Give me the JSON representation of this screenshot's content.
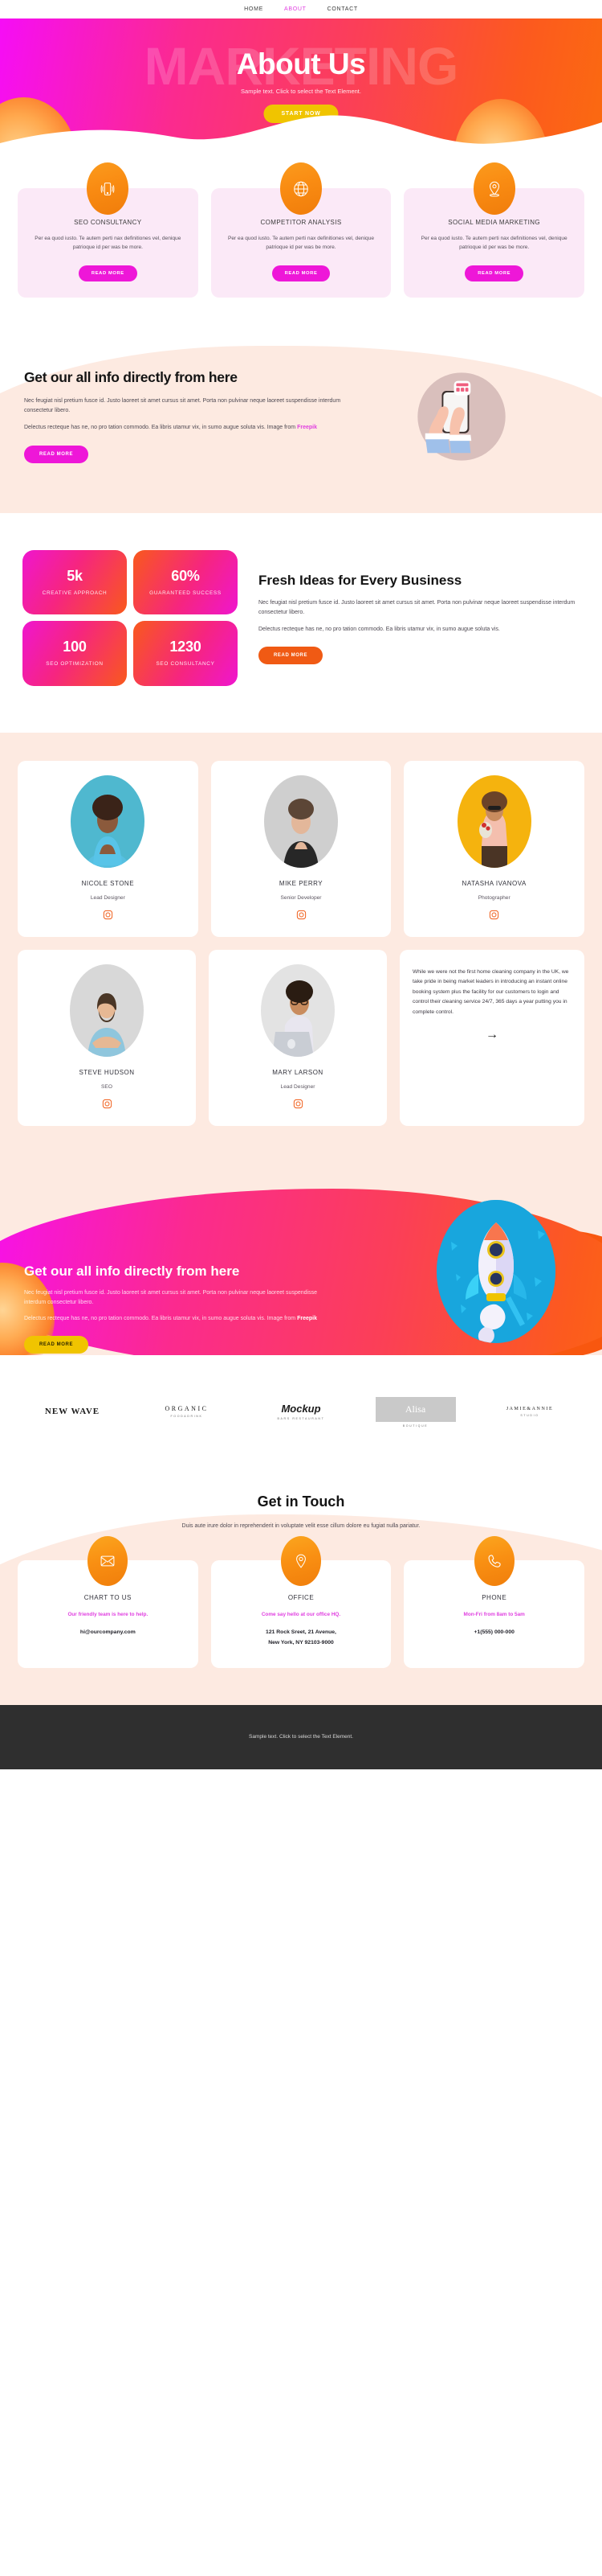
{
  "nav": {
    "items": [
      {
        "label": "HOME",
        "active": false
      },
      {
        "label": "ABOUT",
        "active": true
      },
      {
        "label": "CONTACT",
        "active": false
      }
    ]
  },
  "hero": {
    "ghost_text": "MARKETING",
    "title": "About Us",
    "subtitle": "Sample text. Click to select the Text Element.",
    "cta_label": "START NOW",
    "gradient_from": "#f60df6",
    "gradient_to": "#fb6a10",
    "cta_color": "#f0c400"
  },
  "services": {
    "cards": [
      {
        "icon": "mobile-signal-icon",
        "title": "SEO CONSULTANCY",
        "body": "Per ea quod iusto. Te autem perti nax definitiones vel, denique patrioque id per was be more.",
        "button": "READ MORE"
      },
      {
        "icon": "globe-icon",
        "title": "COMPETITOR ANALYSIS",
        "body": "Per ea quod iusto. Te autem perti nax definitiones vel, denique patrioque id per was be more.",
        "button": "READ MORE"
      },
      {
        "icon": "map-pin-icon",
        "title": "SOCIAL MEDIA MARKETING",
        "body": "Per ea quod iusto. Te autem perti nax definitiones vel, denique patrioque id per was be more.",
        "button": "READ MORE"
      }
    ],
    "card_bg": "#fbe9f7",
    "button_color": "#ee17d8"
  },
  "info": {
    "heading": "Get our all info directly from here",
    "para1": "Nec feugiat nisl pretium fusce id. Justo laoreet sit amet cursus sit amet. Porta non pulvinar neque laoreet suspendisse interdum consectetur libero.",
    "para2_pre": "Delectus recteque has ne, no pro tation commodo. Ea libris utamur vix, in sumo augue soluta vis. Image from ",
    "para2_link": "Freepik",
    "button": "READ MORE",
    "image_alt": "hand-holding-phone-illustration"
  },
  "stats": {
    "tiles": [
      {
        "num": "5k",
        "label": "CREATIVE APPROACH"
      },
      {
        "num": "60%",
        "label": "GUARANTEED SUCCESS"
      },
      {
        "num": "100",
        "label": "SEO OPTIMIZATION"
      },
      {
        "num": "1230",
        "label": "SEO CONSULTANCY"
      }
    ],
    "heading": "Fresh Ideas for Every Business",
    "para1": "Nec feugiat nisl pretium fusce id. Justo laoreet sit amet cursus sit amet. Porta non pulvinar neque laoreet suspendisse interdum consectetur libero.",
    "para2": "Delectus recteque has ne, no pro tation commodo. Ea libris utamur vix, in sumo augue soluta vis.",
    "button": "READ MORE",
    "button_color": "#f05a14"
  },
  "team": {
    "bg": "#fdeae1",
    "row1": [
      {
        "name": "NICOLE STONE",
        "role": "Lead Designer",
        "photo_bg": "#4fb8cf",
        "icon": "instagram-icon"
      },
      {
        "name": "MIKE PERRY",
        "role": "Senior Developer",
        "photo_bg": "#cfcfcf",
        "icon": "instagram-icon"
      },
      {
        "name": "NATASHA IVANOVA",
        "role": "Photographer",
        "photo_bg": "#f5b30e",
        "icon": "instagram-icon"
      }
    ],
    "row2": [
      {
        "name": "STEVE HUDSON",
        "role": "SEO",
        "photo_bg": "#d8d8d8",
        "icon": "instagram-icon"
      },
      {
        "name": "MARY LARSON",
        "role": "Lead Designer",
        "photo_bg": "#e3e3e3",
        "icon": "instagram-icon"
      }
    ],
    "quote": {
      "text": "While we were not the first home cleaning company in the UK, we take pride in being market leaders in introducing an instant online booking system plus the facility for our customers to login and control their cleaning service 24/7, 365 days a year putting you in complete control.",
      "arrow": "→"
    }
  },
  "rocket": {
    "heading": "Get our all info directly from here",
    "para1": "Nec feugiat nisl pretium fusce id. Justo laoreet sit amet cursus sit amet. Porta non pulvinar neque laoreet suspendisse interdum consectetur libero.",
    "para2_pre": "Delectus recteque has ne, no pro tation commodo. Ea libris utamur vix, in sumo augue soluta vis. Image from ",
    "para2_link": "Freepik",
    "button": "READ MORE",
    "button_color": "#f0c400",
    "image_alt": "rocket-illustration",
    "circle_bg": "#18a6dd"
  },
  "logos": [
    {
      "main": "NEW WAVE",
      "sub": ""
    },
    {
      "main": "ORGANIC",
      "sub": "FOOD&DRINK"
    },
    {
      "main": "Mockup",
      "sub": "BARS RESTAURANT"
    },
    {
      "main": "Alisa",
      "sub": "BOUTIQUE"
    },
    {
      "main": "JAMIE&ANNIE",
      "sub": "STUDIO"
    }
  ],
  "contact": {
    "heading": "Get in Touch",
    "lead": "Duis aute irure dolor in reprehenderit in voluptate velit esse cillum dolore eu fugiat nulla pariatur.",
    "cards": [
      {
        "icon": "envelope-icon",
        "title": "CHART TO US",
        "tag": "Our friendly team is here to help.",
        "value1": "hi@ourcompany.com",
        "value2": ""
      },
      {
        "icon": "map-pin-icon",
        "title": "OFFICE",
        "tag": "Come say hello at our office HQ.",
        "value1": "121 Rock Sreet, 21 Avenue,",
        "value2": "New York, NY 92103-9000"
      },
      {
        "icon": "phone-icon",
        "title": "PHONE",
        "tag": "Mon-Fri from 8am to 5am",
        "value1": "+1(555) 000-000",
        "value2": ""
      }
    ],
    "tag_color": "#e040e0"
  },
  "footer": {
    "text": "Sample text. Click to select the Text Element.",
    "bg": "#2f2f2f"
  }
}
